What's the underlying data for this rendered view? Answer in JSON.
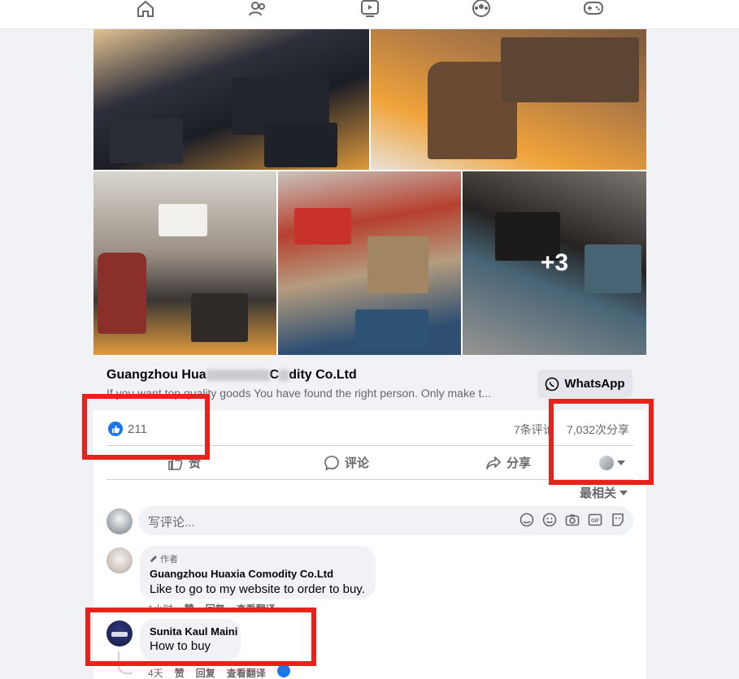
{
  "nav": {
    "icons": [
      "home-icon",
      "friends-icon",
      "watch-icon",
      "groups-icon",
      "gaming-icon"
    ]
  },
  "post": {
    "more_photos_label": "+3",
    "link": {
      "title_start": "Guangzhou Hua",
      "title_end": "C",
      "title_end2": "dity Co.Ltd",
      "description": "If you want top quality goods You have found the right person. Only make t...",
      "whatsapp_label": "WhatsApp"
    },
    "stats": {
      "likes": "211",
      "comments": "7条评论",
      "shares": "7,032次分享"
    },
    "actions": {
      "like": "赞",
      "comment": "评论",
      "share": "分享"
    },
    "sort_label": "最相关",
    "comment_placeholder": "写评论..."
  },
  "comments": [
    {
      "author_tag": "作者",
      "name": "Guangzhou Huaxia Comodity Co.Ltd",
      "text": "Like to go to my website to order to buy.",
      "time": "1小时",
      "like": "赞",
      "reply": "回复",
      "translate": "查看翻译"
    },
    {
      "name": "Sunita Kaul Maini",
      "text": "How to buy",
      "time": "4天",
      "like": "赞",
      "reply": "回复",
      "translate": "查看翻译"
    }
  ],
  "colors": {
    "accent": "#1877f2",
    "highlight": "#e8221b",
    "whatsapp": "#25d366"
  }
}
